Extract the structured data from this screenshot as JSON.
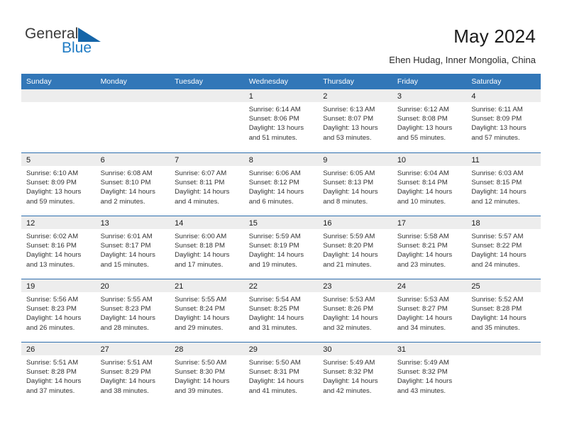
{
  "brand": {
    "name_part1": "General",
    "name_part2": "Blue",
    "triangle_color": "#1565a8",
    "blue_color": "#1f7bc4"
  },
  "header": {
    "title": "May 2024",
    "subtitle": "Ehen Hudag, Inner Mongolia, China"
  },
  "theme": {
    "header_blue": "#3277b8",
    "day_bar_gray": "#ededed",
    "divider_blue": "#2f6fae"
  },
  "weekdays": [
    "Sunday",
    "Monday",
    "Tuesday",
    "Wednesday",
    "Thursday",
    "Friday",
    "Saturday"
  ],
  "weeks": [
    [
      {
        "day": "",
        "l1": "",
        "l2": "",
        "l3": "",
        "l4": ""
      },
      {
        "day": "",
        "l1": "",
        "l2": "",
        "l3": "",
        "l4": ""
      },
      {
        "day": "",
        "l1": "",
        "l2": "",
        "l3": "",
        "l4": ""
      },
      {
        "day": "1",
        "l1": "Sunrise: 6:14 AM",
        "l2": "Sunset: 8:06 PM",
        "l3": "Daylight: 13 hours",
        "l4": "and 51 minutes."
      },
      {
        "day": "2",
        "l1": "Sunrise: 6:13 AM",
        "l2": "Sunset: 8:07 PM",
        "l3": "Daylight: 13 hours",
        "l4": "and 53 minutes."
      },
      {
        "day": "3",
        "l1": "Sunrise: 6:12 AM",
        "l2": "Sunset: 8:08 PM",
        "l3": "Daylight: 13 hours",
        "l4": "and 55 minutes."
      },
      {
        "day": "4",
        "l1": "Sunrise: 6:11 AM",
        "l2": "Sunset: 8:09 PM",
        "l3": "Daylight: 13 hours",
        "l4": "and 57 minutes."
      }
    ],
    [
      {
        "day": "5",
        "l1": "Sunrise: 6:10 AM",
        "l2": "Sunset: 8:09 PM",
        "l3": "Daylight: 13 hours",
        "l4": "and 59 minutes."
      },
      {
        "day": "6",
        "l1": "Sunrise: 6:08 AM",
        "l2": "Sunset: 8:10 PM",
        "l3": "Daylight: 14 hours",
        "l4": "and 2 minutes."
      },
      {
        "day": "7",
        "l1": "Sunrise: 6:07 AM",
        "l2": "Sunset: 8:11 PM",
        "l3": "Daylight: 14 hours",
        "l4": "and 4 minutes."
      },
      {
        "day": "8",
        "l1": "Sunrise: 6:06 AM",
        "l2": "Sunset: 8:12 PM",
        "l3": "Daylight: 14 hours",
        "l4": "and 6 minutes."
      },
      {
        "day": "9",
        "l1": "Sunrise: 6:05 AM",
        "l2": "Sunset: 8:13 PM",
        "l3": "Daylight: 14 hours",
        "l4": "and 8 minutes."
      },
      {
        "day": "10",
        "l1": "Sunrise: 6:04 AM",
        "l2": "Sunset: 8:14 PM",
        "l3": "Daylight: 14 hours",
        "l4": "and 10 minutes."
      },
      {
        "day": "11",
        "l1": "Sunrise: 6:03 AM",
        "l2": "Sunset: 8:15 PM",
        "l3": "Daylight: 14 hours",
        "l4": "and 12 minutes."
      }
    ],
    [
      {
        "day": "12",
        "l1": "Sunrise: 6:02 AM",
        "l2": "Sunset: 8:16 PM",
        "l3": "Daylight: 14 hours",
        "l4": "and 13 minutes."
      },
      {
        "day": "13",
        "l1": "Sunrise: 6:01 AM",
        "l2": "Sunset: 8:17 PM",
        "l3": "Daylight: 14 hours",
        "l4": "and 15 minutes."
      },
      {
        "day": "14",
        "l1": "Sunrise: 6:00 AM",
        "l2": "Sunset: 8:18 PM",
        "l3": "Daylight: 14 hours",
        "l4": "and 17 minutes."
      },
      {
        "day": "15",
        "l1": "Sunrise: 5:59 AM",
        "l2": "Sunset: 8:19 PM",
        "l3": "Daylight: 14 hours",
        "l4": "and 19 minutes."
      },
      {
        "day": "16",
        "l1": "Sunrise: 5:59 AM",
        "l2": "Sunset: 8:20 PM",
        "l3": "Daylight: 14 hours",
        "l4": "and 21 minutes."
      },
      {
        "day": "17",
        "l1": "Sunrise: 5:58 AM",
        "l2": "Sunset: 8:21 PM",
        "l3": "Daylight: 14 hours",
        "l4": "and 23 minutes."
      },
      {
        "day": "18",
        "l1": "Sunrise: 5:57 AM",
        "l2": "Sunset: 8:22 PM",
        "l3": "Daylight: 14 hours",
        "l4": "and 24 minutes."
      }
    ],
    [
      {
        "day": "19",
        "l1": "Sunrise: 5:56 AM",
        "l2": "Sunset: 8:23 PM",
        "l3": "Daylight: 14 hours",
        "l4": "and 26 minutes."
      },
      {
        "day": "20",
        "l1": "Sunrise: 5:55 AM",
        "l2": "Sunset: 8:23 PM",
        "l3": "Daylight: 14 hours",
        "l4": "and 28 minutes."
      },
      {
        "day": "21",
        "l1": "Sunrise: 5:55 AM",
        "l2": "Sunset: 8:24 PM",
        "l3": "Daylight: 14 hours",
        "l4": "and 29 minutes."
      },
      {
        "day": "22",
        "l1": "Sunrise: 5:54 AM",
        "l2": "Sunset: 8:25 PM",
        "l3": "Daylight: 14 hours",
        "l4": "and 31 minutes."
      },
      {
        "day": "23",
        "l1": "Sunrise: 5:53 AM",
        "l2": "Sunset: 8:26 PM",
        "l3": "Daylight: 14 hours",
        "l4": "and 32 minutes."
      },
      {
        "day": "24",
        "l1": "Sunrise: 5:53 AM",
        "l2": "Sunset: 8:27 PM",
        "l3": "Daylight: 14 hours",
        "l4": "and 34 minutes."
      },
      {
        "day": "25",
        "l1": "Sunrise: 5:52 AM",
        "l2": "Sunset: 8:28 PM",
        "l3": "Daylight: 14 hours",
        "l4": "and 35 minutes."
      }
    ],
    [
      {
        "day": "26",
        "l1": "Sunrise: 5:51 AM",
        "l2": "Sunset: 8:28 PM",
        "l3": "Daylight: 14 hours",
        "l4": "and 37 minutes."
      },
      {
        "day": "27",
        "l1": "Sunrise: 5:51 AM",
        "l2": "Sunset: 8:29 PM",
        "l3": "Daylight: 14 hours",
        "l4": "and 38 minutes."
      },
      {
        "day": "28",
        "l1": "Sunrise: 5:50 AM",
        "l2": "Sunset: 8:30 PM",
        "l3": "Daylight: 14 hours",
        "l4": "and 39 minutes."
      },
      {
        "day": "29",
        "l1": "Sunrise: 5:50 AM",
        "l2": "Sunset: 8:31 PM",
        "l3": "Daylight: 14 hours",
        "l4": "and 41 minutes."
      },
      {
        "day": "30",
        "l1": "Sunrise: 5:49 AM",
        "l2": "Sunset: 8:32 PM",
        "l3": "Daylight: 14 hours",
        "l4": "and 42 minutes."
      },
      {
        "day": "31",
        "l1": "Sunrise: 5:49 AM",
        "l2": "Sunset: 8:32 PM",
        "l3": "Daylight: 14 hours",
        "l4": "and 43 minutes."
      },
      {
        "day": "",
        "l1": "",
        "l2": "",
        "l3": "",
        "l4": ""
      }
    ]
  ]
}
